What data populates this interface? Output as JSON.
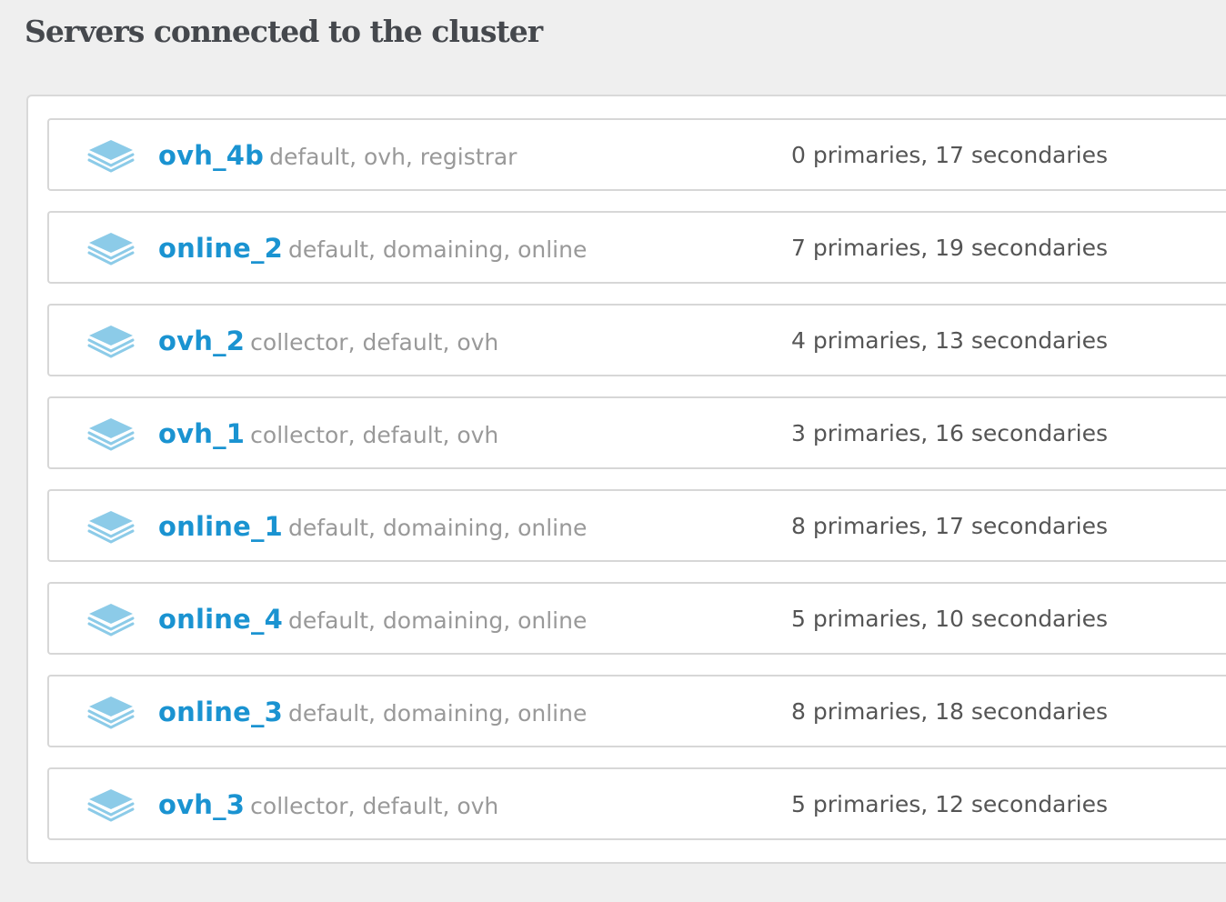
{
  "page": {
    "title": "Servers connected to the cluster"
  },
  "colors": {
    "server_name": "#1a93d1",
    "tags": "#999999",
    "stats": "#555555",
    "title": "#45484d",
    "icon": "#8ccbe8"
  },
  "servers": [
    {
      "name": "ovh_4b",
      "tags": "default, ovh, registrar",
      "stats": "0 primaries, 17 secondaries",
      "icon": "layers-icon"
    },
    {
      "name": "online_2",
      "tags": "default, domaining, online",
      "stats": "7 primaries, 19 secondaries",
      "icon": "layers-icon"
    },
    {
      "name": "ovh_2",
      "tags": "collector, default, ovh",
      "stats": "4 primaries, 13 secondaries",
      "icon": "layers-icon"
    },
    {
      "name": "ovh_1",
      "tags": "collector, default, ovh",
      "stats": "3 primaries, 16 secondaries",
      "icon": "layers-icon"
    },
    {
      "name": "online_1",
      "tags": "default, domaining, online",
      "stats": "8 primaries, 17 secondaries",
      "icon": "layers-icon"
    },
    {
      "name": "online_4",
      "tags": "default, domaining, online",
      "stats": "5 primaries, 10 secondaries",
      "icon": "layers-icon"
    },
    {
      "name": "online_3",
      "tags": "default, domaining, online",
      "stats": "8 primaries, 18 secondaries",
      "icon": "layers-icon"
    },
    {
      "name": "ovh_3",
      "tags": "collector, default, ovh",
      "stats": "5 primaries, 12 secondaries",
      "icon": "layers-icon"
    }
  ]
}
